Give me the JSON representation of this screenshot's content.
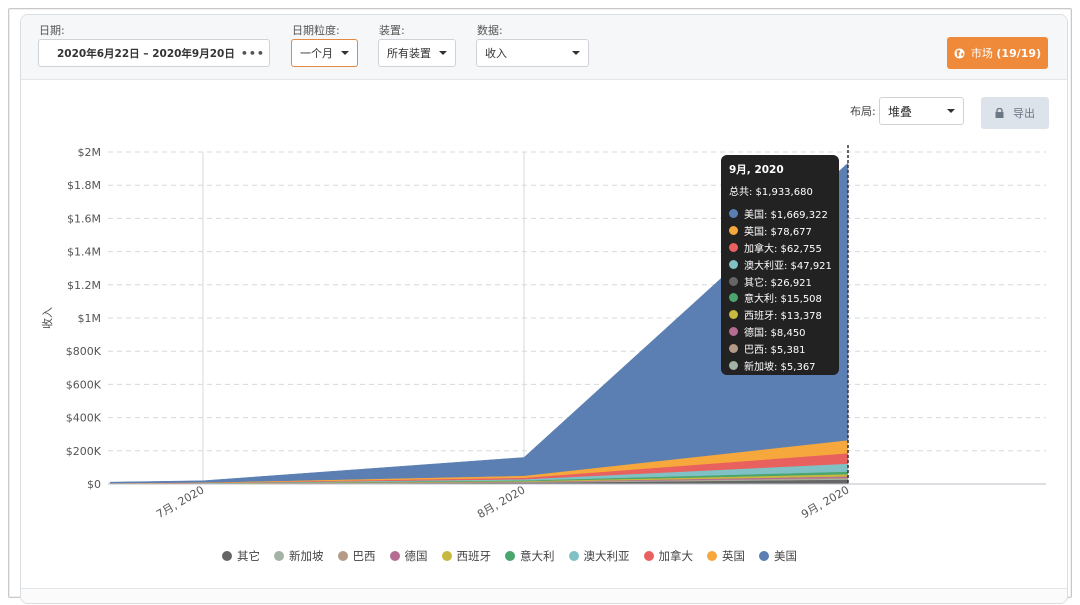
{
  "filters": {
    "date_label": "日期:",
    "date_range": "2020年6月22日  –  2020年9月20日",
    "date_more": "•••",
    "granularity_label": "日期粒度:",
    "granularity_value": "一个月",
    "device_label": "装置:",
    "device_value": "所有装置",
    "data_label": "数据:",
    "data_value": "收入",
    "market_button_prefix": "市场",
    "market_button_count": "(19/19)"
  },
  "toolbar": {
    "layout_label": "布局:",
    "layout_value": "堆叠",
    "export_label": "导出"
  },
  "colors": {
    "accent": "#ef8a3a",
    "tooltip_bg": "#222222"
  },
  "tooltip": {
    "title": "9月, 2020",
    "total": "总共: $1,933,680",
    "rows": [
      {
        "label": "美国: $1,669,322",
        "color": "#5b7fb2"
      },
      {
        "label": "英国: $78,677",
        "color": "#f6a83c"
      },
      {
        "label": "加拿大: $62,755",
        "color": "#e8615f"
      },
      {
        "label": "澳大利亚: $47,921",
        "color": "#7fc1c5"
      },
      {
        "label": "其它: $26,921",
        "color": "#666666"
      },
      {
        "label": "意大利: $15,508",
        "color": "#4aa56f"
      },
      {
        "label": "西班牙: $13,378",
        "color": "#c7b83f"
      },
      {
        "label": "德国: $8,450",
        "color": "#b46c93"
      },
      {
        "label": "巴西: $5,381",
        "color": "#b59a88"
      },
      {
        "label": "新加坡: $5,367",
        "color": "#a3b4a6"
      }
    ]
  },
  "chart_data": {
    "type": "area",
    "stacked": true,
    "ylabel": "收入",
    "ylim": [
      0,
      2000000
    ],
    "y_ticks": [
      0,
      200000,
      400000,
      600000,
      800000,
      1000000,
      1200000,
      1400000,
      1600000,
      1800000,
      2000000
    ],
    "y_tick_labels": [
      "$0",
      "$200K",
      "$400K",
      "$600K",
      "$800K",
      "$1M",
      "$1.2M",
      "$1.4M",
      "$1.6M",
      "$1.8M",
      "$2M"
    ],
    "x_labels": [
      "7月, 2020",
      "8月, 2020",
      "9月, 2020"
    ],
    "x": [
      "2020-06-22",
      "2020-07-01",
      "2020-08-01",
      "2020-09-01"
    ],
    "grid": true,
    "legend_position": "bottom",
    "series": [
      {
        "name": "其它",
        "color": "#666666",
        "values": [
          1500,
          2500,
          8000,
          26921
        ]
      },
      {
        "name": "新加坡",
        "color": "#a3b4a6",
        "values": [
          200,
          300,
          1500,
          5367
        ]
      },
      {
        "name": "巴西",
        "color": "#b59a88",
        "values": [
          200,
          300,
          1500,
          5381
        ]
      },
      {
        "name": "德国",
        "color": "#b46c93",
        "values": [
          300,
          500,
          2500,
          8450
        ]
      },
      {
        "name": "西班牙",
        "color": "#c7b83f",
        "values": [
          400,
          700,
          4000,
          13378
        ]
      },
      {
        "name": "意大利",
        "color": "#4aa56f",
        "values": [
          400,
          700,
          4500,
          15508
        ]
      },
      {
        "name": "澳大利亚",
        "color": "#7fc1c5",
        "values": [
          600,
          1200,
          7000,
          47921
        ]
      },
      {
        "name": "加拿大",
        "color": "#e8615f",
        "values": [
          800,
          1500,
          9000,
          62755
        ]
      },
      {
        "name": "英国",
        "color": "#f6a83c",
        "values": [
          1000,
          2000,
          12000,
          78677
        ]
      },
      {
        "name": "美国",
        "color": "#5b7fb2",
        "values": [
          6000,
          10000,
          110000,
          1669322
        ]
      }
    ],
    "legend_order": [
      "其它",
      "新加坡",
      "巴西",
      "德国",
      "西班牙",
      "意大利",
      "澳大利亚",
      "加拿大",
      "英国",
      "美国"
    ]
  }
}
